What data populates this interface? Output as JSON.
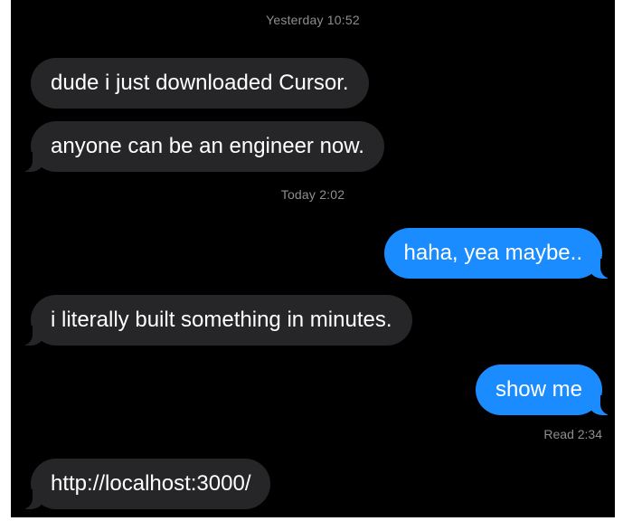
{
  "conversation": {
    "timestamps": {
      "yesterday": "Yesterday 10:52",
      "today": "Today 2:02"
    },
    "messages": [
      {
        "sender": "them",
        "text": "dude i just downloaded Cursor."
      },
      {
        "sender": "them",
        "text": "anyone can be an engineer now."
      },
      {
        "sender": "me",
        "text": "haha, yea maybe.."
      },
      {
        "sender": "them",
        "text": "i literally built something in minutes."
      },
      {
        "sender": "me",
        "text": "show me"
      },
      {
        "sender": "them",
        "text": "http://localhost:3000/"
      }
    ],
    "read_receipt": "Read 2:34"
  },
  "colors": {
    "background": "#000000",
    "incoming_bubble": "#262628",
    "outgoing_bubble": "#1a8cff",
    "timestamp_text": "#8e8e93"
  }
}
